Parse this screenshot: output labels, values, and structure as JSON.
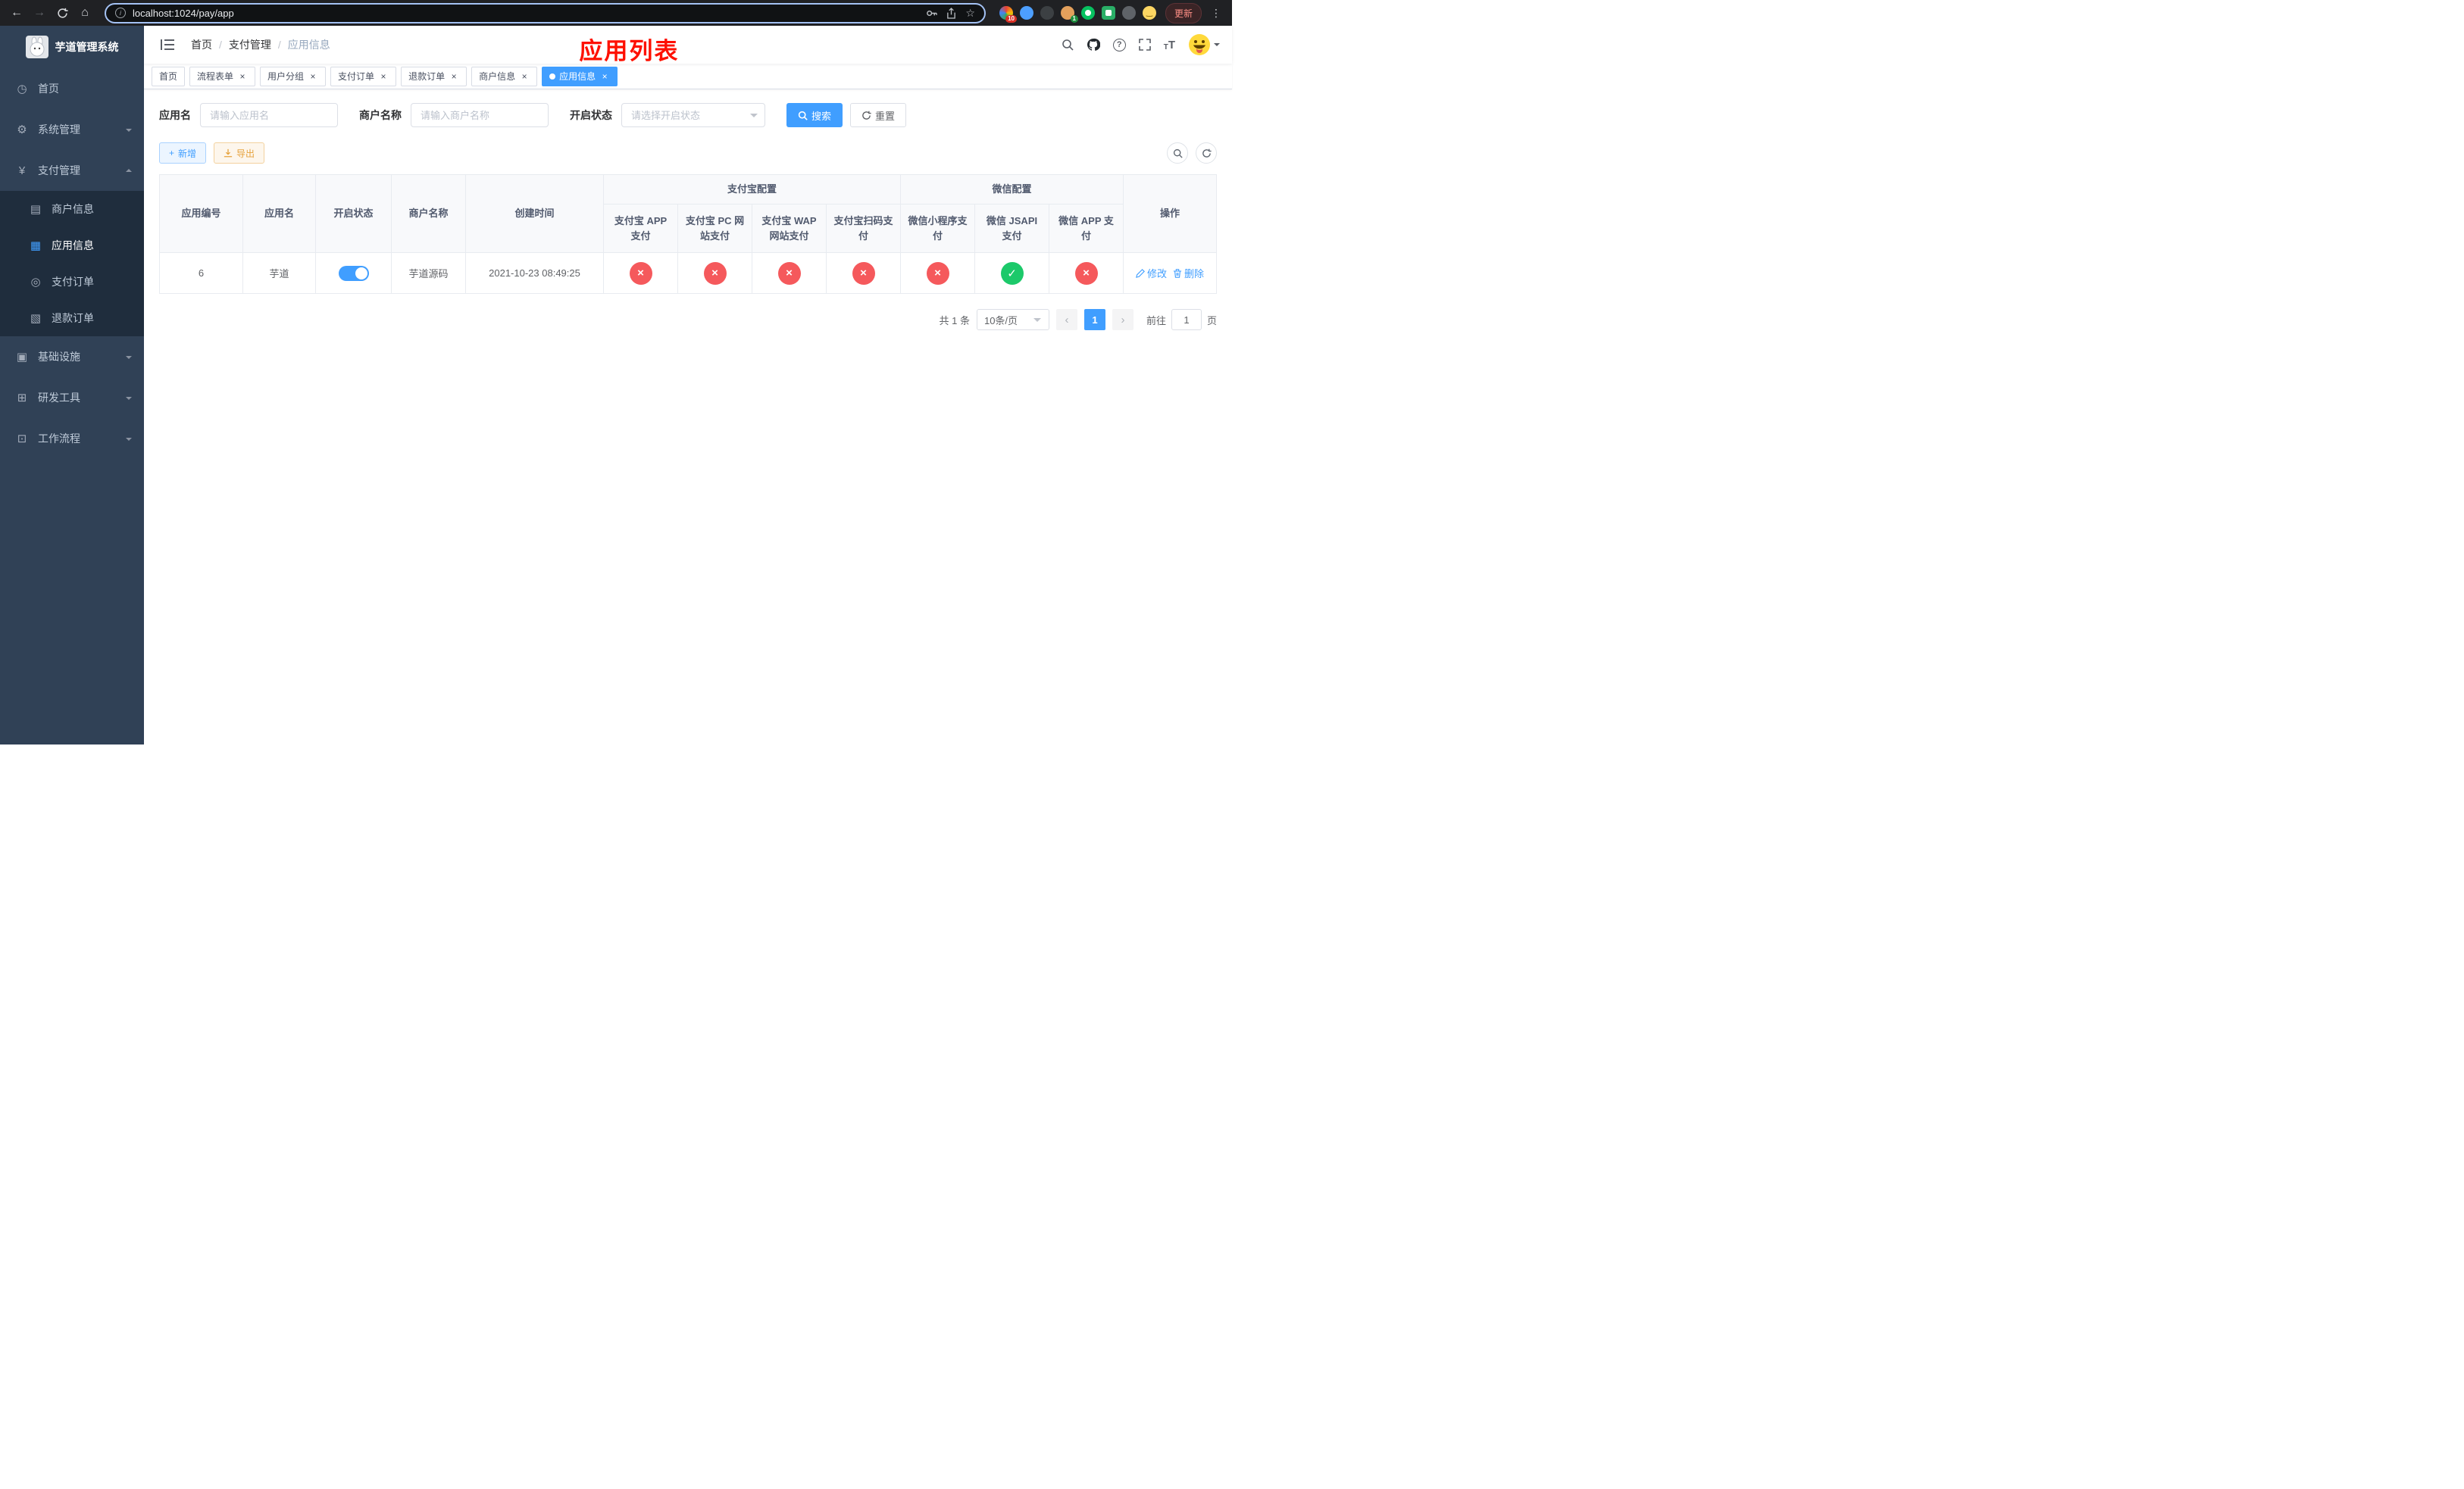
{
  "colors": {
    "primary": "#409eff",
    "success": "#1cc96a",
    "danger": "#f5595c",
    "warning": "#e6a23c",
    "annotation": "#fe1000",
    "sidebar_bg": "#304156",
    "sidebar_sub_bg": "#1f2d3d",
    "chrome_bg": "#202124"
  },
  "browser": {
    "url": "localhost:1024/pay/app",
    "update_button": "更新",
    "extension_badge_puzzle": "10",
    "extension_badge_profile": "1"
  },
  "sidebar": {
    "title": "芋道管理系统",
    "items": [
      {
        "label": "首页",
        "icon": "dashboard-icon",
        "glyph": "◷"
      },
      {
        "label": "系统管理",
        "icon": "gear-icon",
        "glyph": "⚙"
      },
      {
        "label": "支付管理",
        "icon": "yen-icon",
        "glyph": "¥"
      },
      {
        "label": "商户信息",
        "icon": "merchant-card-icon",
        "glyph": "▤"
      },
      {
        "label": "应用信息",
        "icon": "app-grid-icon",
        "glyph": "▦"
      },
      {
        "label": "支付订单",
        "icon": "pay-order-icon",
        "glyph": "◎"
      },
      {
        "label": "退款订单",
        "icon": "refund-order-icon",
        "glyph": "▧"
      },
      {
        "label": "基础设施",
        "icon": "infrastructure-icon",
        "glyph": "▣"
      },
      {
        "label": "研发工具",
        "icon": "dev-tools-icon",
        "glyph": "⊞"
      },
      {
        "label": "工作流程",
        "icon": "workflow-icon",
        "glyph": "⊡"
      }
    ]
  },
  "header": {
    "breadcrumb": [
      "首页",
      "支付管理",
      "应用信息"
    ],
    "annotation": "应用列表"
  },
  "tabs": [
    {
      "label": "首页"
    },
    {
      "label": "流程表单"
    },
    {
      "label": "用户分组"
    },
    {
      "label": "支付订单"
    },
    {
      "label": "退款订单"
    },
    {
      "label": "商户信息"
    },
    {
      "label": "应用信息"
    }
  ],
  "filters": {
    "app_name_label": "应用名",
    "app_name_placeholder": "请输入应用名",
    "merchant_label": "商户名称",
    "merchant_placeholder": "请输入商户名称",
    "status_label": "开启状态",
    "status_placeholder": "请选择开启状态",
    "search_button": "搜索",
    "reset_button": "重置"
  },
  "toolbar": {
    "add_button": "新增",
    "export_button": "导出"
  },
  "table": {
    "groups": {
      "alipay": "支付宝配置",
      "wechat": "微信配置"
    },
    "columns": {
      "app_id": "应用编号",
      "app_name": "应用名",
      "status": "开启状态",
      "merchant_name": "商户名称",
      "create_time": "创建时间",
      "alipay_app": "支付宝 APP 支付",
      "alipay_pc": "支付宝 PC 网站支付",
      "alipay_wap": "支付宝 WAP 网站支付",
      "alipay_qr": "支付宝扫码支付",
      "wechat_mini": "微信小程序支付",
      "wechat_jsapi": "微信 JSAPI 支付",
      "wechat_app": "微信 APP 支付",
      "actions": "操作"
    },
    "rows": [
      {
        "app_id": "6",
        "app_name": "芋道",
        "status_on": true,
        "merchant_name": "芋道源码",
        "create_time": "2021-10-23 08:49:25",
        "configs": [
          false,
          false,
          false,
          false,
          false,
          true,
          false
        ],
        "edit": "修改",
        "delete": "删除"
      }
    ]
  },
  "pagination": {
    "total": "共 1 条",
    "page_size": "10条/页",
    "current_page": "1",
    "goto_prefix": "前往",
    "goto_value": "1",
    "goto_suffix": "页"
  }
}
